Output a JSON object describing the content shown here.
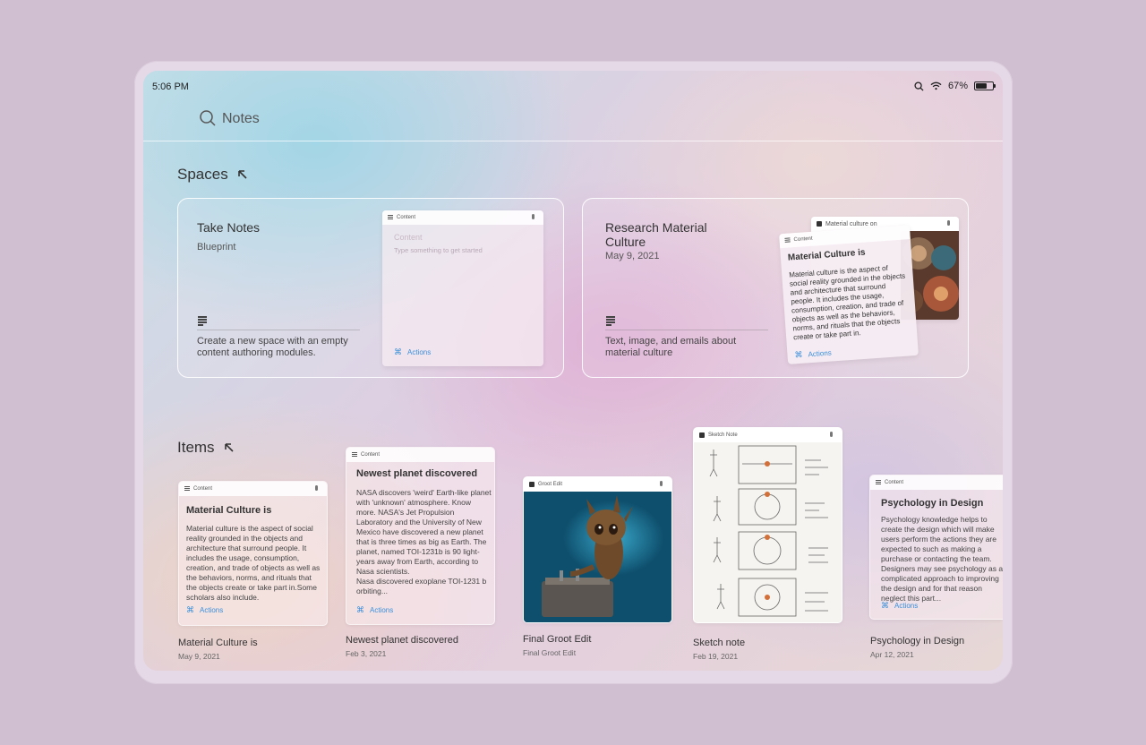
{
  "status": {
    "time": "5:06 PM",
    "battery": "67%",
    "battery_level": 0.67
  },
  "search": {
    "label": "Notes"
  },
  "spaces": {
    "title": "Spaces",
    "cards": [
      {
        "title": "Take Notes",
        "subtitle": "Blueprint",
        "description": "Create a new space with an empty content authoring modules.",
        "preview": {
          "header": "Content",
          "title_placeholder": "Content",
          "body_placeholder": "Type something to get started",
          "actions": "Actions"
        }
      },
      {
        "title": "Research Material Culture",
        "subtitle": "May 9, 2021",
        "description": "Text, image, and emails about material culture",
        "preview_back": {
          "header": "Material culture on"
        },
        "preview": {
          "header": "Content",
          "title": "Material Culture is",
          "body": "Material culture is the aspect of social reality grounded in the objects and architecture that surround people. It includes the usage, consumption, creation, and trade of objects as well as the behaviors, norms, and rituals that the objects create or take part in.",
          "actions": "Actions"
        }
      }
    ]
  },
  "items": {
    "title": "Items",
    "list": [
      {
        "header": "Content",
        "card_title": "Material Culture is",
        "body": "Material culture is the aspect of social reality grounded in the objects and architecture that surround people. It includes the usage, consumption, creation, and trade of objects as well as the behaviors, norms, and rituals that the objects create or take part in.Some scholars also include.",
        "actions": "Actions",
        "label": "Material Culture is",
        "date": "May 9, 2021"
      },
      {
        "header": "Content",
        "card_title": "Newest planet discovered",
        "body": "NASA discovers 'weird' Earth-like planet with 'unknown' atmosphere. Know more. NASA's Jet Propulsion Laboratory and the University of New Mexico have discovered a new planet that is three times as big as Earth. The planet, named TOI-1231b is 90 light-years away from Earth, according to Nasa scientists.",
        "body2": "Nasa discovered exoplane TOI-1231 b orbiting...",
        "actions": "Actions",
        "label": "Newest planet discovered",
        "date": "Feb 3, 2021"
      },
      {
        "header": "Groot Edit",
        "label": "Final Groot Edit",
        "date": "Final Groot Edit"
      },
      {
        "header": "Sketch Note",
        "label": "Sketch note",
        "date": "Feb 19, 2021"
      },
      {
        "header": "Content",
        "card_title": "Psychology in Design",
        "body": "Psychology knowledge helps to create the design which will make users perform the actions they are expected to such as making a purchase or contacting the team. Designers may see psychology as a complicated approach to improving the design and for that reason neglect this part...",
        "actions": "Actions",
        "label": "Psychology in Design",
        "date": "Apr 12, 2021"
      }
    ]
  },
  "colors": {
    "accent": "#3a8fdb",
    "background": "#cfbfd1"
  }
}
